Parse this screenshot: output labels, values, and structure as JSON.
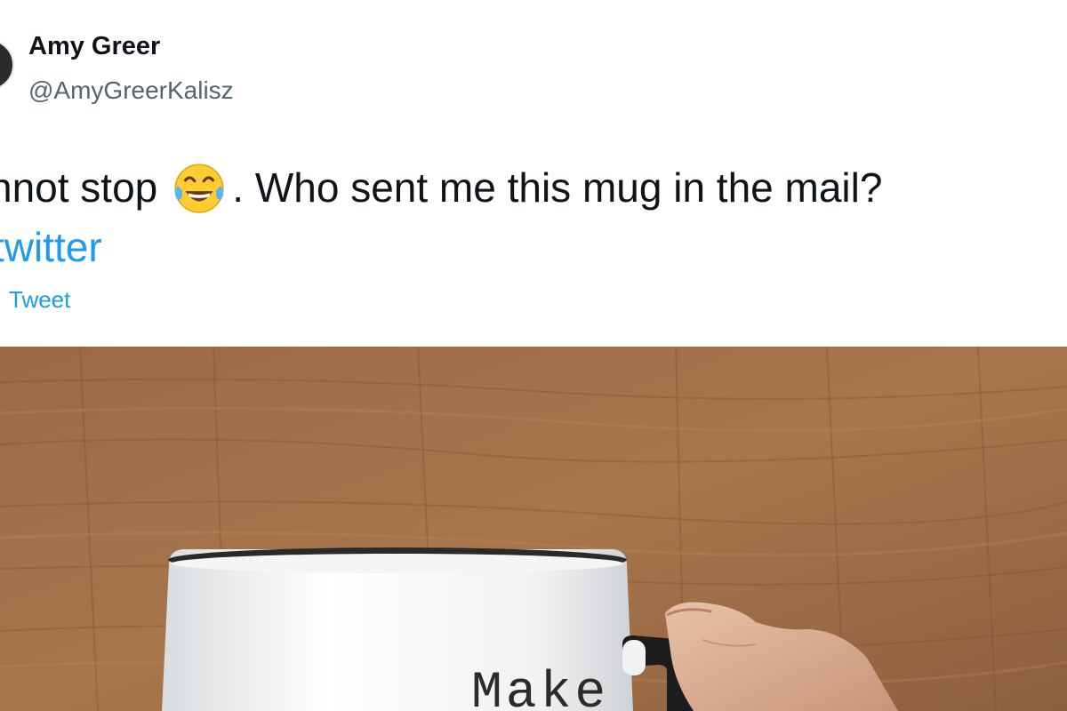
{
  "author": {
    "name": "Amy Greer",
    "handle": "@AmyGreerKalisz"
  },
  "tweet": {
    "text_before_emoji": "nnot stop",
    "emoji": "face-with-tears-of-joy",
    "text_after_emoji": ". Who sent me this mug in the mail?",
    "hashtag": "twitter",
    "translate_label": "Tweet"
  },
  "photo": {
    "mug_text": "Make"
  },
  "colors": {
    "link": "#1d9bf0",
    "text": "#0f1419",
    "secondary": "#536471"
  }
}
